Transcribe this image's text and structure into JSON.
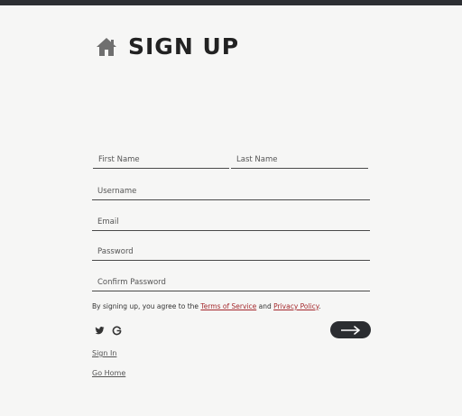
{
  "header": {
    "title": "SIGN UP",
    "icon": "home-icon"
  },
  "form": {
    "first_name": {
      "placeholder": "First Name",
      "value": ""
    },
    "last_name": {
      "placeholder": "Last Name",
      "value": ""
    },
    "username": {
      "placeholder": "Username",
      "value": ""
    },
    "email": {
      "placeholder": "Email",
      "value": ""
    },
    "password": {
      "placeholder": "Password",
      "value": ""
    },
    "confirm_password": {
      "placeholder": "Confirm Password",
      "value": ""
    }
  },
  "agreement": {
    "prefix": "By signing up, you agree to the ",
    "terms": "Terms of Service",
    "middle": " and ",
    "privacy": "Privacy Policy",
    "suffix": "."
  },
  "social": [
    "twitter-icon",
    "google-icon"
  ],
  "submit": {
    "icon": "arrow-right-icon"
  },
  "links": {
    "sign_in": "Sign In",
    "go_home": "Go Home"
  },
  "colors": {
    "link_red": "#a4282c",
    "button_dark": "#2b2d31",
    "top_bar": "#2d2f33",
    "background": "#f6f6f5"
  }
}
